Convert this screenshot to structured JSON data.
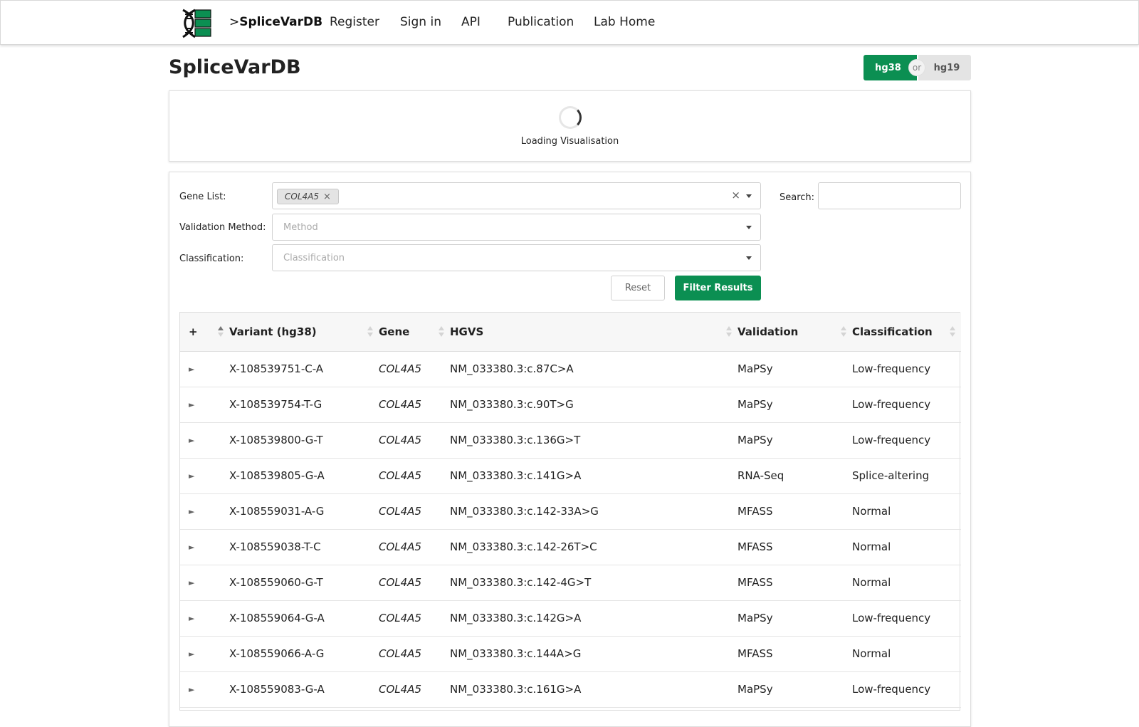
{
  "navbar": {
    "brand": "SpliceVarDB",
    "brand_prefix": ">",
    "links": [
      "Register",
      "Sign in",
      "API",
      "Publication",
      "Lab Home"
    ]
  },
  "page": {
    "title": "SpliceVarDB"
  },
  "build_toggle": {
    "active": "hg38",
    "separator": "or",
    "other": "hg19"
  },
  "visualisation": {
    "loading_text": "Loading Visualisation"
  },
  "filters": {
    "gene_list_label": "Gene List:",
    "gene_tag": "COL4A5",
    "validation_label": "Validation Method:",
    "validation_placeholder": "Method",
    "classification_label": "Classification:",
    "classification_placeholder": "Classification",
    "search_label": "Search:",
    "search_value": "",
    "reset_label": "Reset",
    "filter_label": "Filter Results"
  },
  "table": {
    "columns": [
      "+",
      "Variant (hg38)",
      "Gene",
      "HGVS",
      "Validation",
      "Classification"
    ],
    "expand_glyph": "►",
    "rows": [
      {
        "variant": "X-108539751-C-A",
        "gene": "COL4A5",
        "hgvs": "NM_033380.3:c.87C>A",
        "validation": "MaPSy",
        "classification": "Low-frequency"
      },
      {
        "variant": "X-108539754-T-G",
        "gene": "COL4A5",
        "hgvs": "NM_033380.3:c.90T>G",
        "validation": "MaPSy",
        "classification": "Low-frequency"
      },
      {
        "variant": "X-108539800-G-T",
        "gene": "COL4A5",
        "hgvs": "NM_033380.3:c.136G>T",
        "validation": "MaPSy",
        "classification": "Low-frequency"
      },
      {
        "variant": "X-108539805-G-A",
        "gene": "COL4A5",
        "hgvs": "NM_033380.3:c.141G>A",
        "validation": "RNA-Seq",
        "classification": "Splice-altering"
      },
      {
        "variant": "X-108559031-A-G",
        "gene": "COL4A5",
        "hgvs": "NM_033380.3:c.142-33A>G",
        "validation": "MFASS",
        "classification": "Normal"
      },
      {
        "variant": "X-108559038-T-C",
        "gene": "COL4A5",
        "hgvs": "NM_033380.3:c.142-26T>C",
        "validation": "MFASS",
        "classification": "Normal"
      },
      {
        "variant": "X-108559060-G-T",
        "gene": "COL4A5",
        "hgvs": "NM_033380.3:c.142-4G>T",
        "validation": "MFASS",
        "classification": "Normal"
      },
      {
        "variant": "X-108559064-G-A",
        "gene": "COL4A5",
        "hgvs": "NM_033380.3:c.142G>A",
        "validation": "MaPSy",
        "classification": "Low-frequency"
      },
      {
        "variant": "X-108559066-A-G",
        "gene": "COL4A5",
        "hgvs": "NM_033380.3:c.144A>G",
        "validation": "MFASS",
        "classification": "Normal"
      },
      {
        "variant": "X-108559083-G-A",
        "gene": "COL4A5",
        "hgvs": "NM_033380.3:c.161G>A",
        "validation": "MaPSy",
        "classification": "Low-frequency"
      }
    ]
  },
  "colors": {
    "accent": "#0b8f52",
    "toggle_inactive": "#e4e4e4"
  },
  "icons": {
    "logo": "dna-logo-icon",
    "clear": "close-icon",
    "dropdown": "caret-down-icon",
    "sort": "sort-icon",
    "expand": "expand-arrow-icon"
  }
}
